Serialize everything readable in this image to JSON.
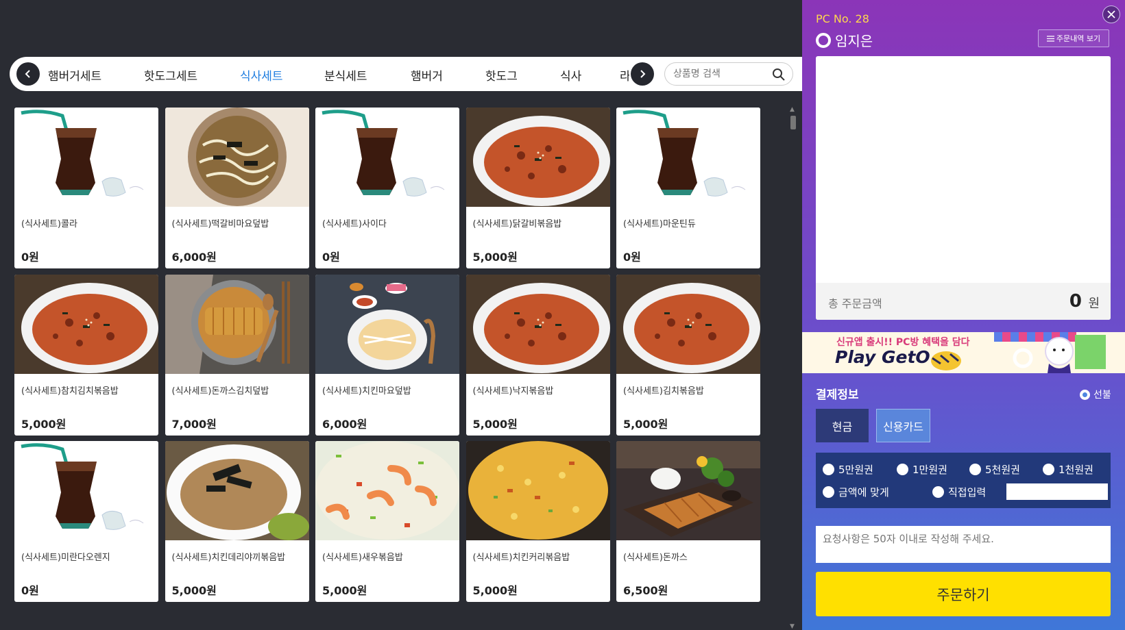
{
  "categories": {
    "items": [
      "햄버거세트",
      "핫도그세트",
      "식사세트",
      "분식세트",
      "햄버거",
      "핫도그",
      "식사"
    ],
    "active_index": 2,
    "clipped_next": "라"
  },
  "search": {
    "placeholder": "상품명 검색"
  },
  "products": [
    {
      "name": "(식사세트)콜라",
      "price": "0원",
      "img": "cola"
    },
    {
      "name": "(식사세트)떡갈비마요덮밥",
      "price": "6,000원",
      "img": "mayo-bowl"
    },
    {
      "name": "(식사세트)사이다",
      "price": "0원",
      "img": "cola"
    },
    {
      "name": "(식사세트)닭갈비볶음밥",
      "price": "5,000원",
      "img": "kimchi-rice"
    },
    {
      "name": "(식사세트)마운틴듀",
      "price": "0원",
      "img": "cola"
    },
    {
      "name": "(식사세트)참치김치볶음밥",
      "price": "5,000원",
      "img": "kimchi-rice"
    },
    {
      "name": "(식사세트)돈까스김치덮밥",
      "price": "7,000원",
      "img": "katsu-bowl"
    },
    {
      "name": "(식사세트)치킨마요덮밥",
      "price": "6,000원",
      "img": "chicken-mayo"
    },
    {
      "name": "(식사세트)낙지볶음밥",
      "price": "5,000원",
      "img": "kimchi-rice"
    },
    {
      "name": "(식사세트)김치볶음밥",
      "price": "5,000원",
      "img": "kimchi-rice"
    },
    {
      "name": "(식사세트)미란다오렌지",
      "price": "0원",
      "img": "cola"
    },
    {
      "name": "(식사세트)치킨데리야끼볶음밥",
      "price": "5,000원",
      "img": "teriyaki-rice"
    },
    {
      "name": "(식사세트)새우볶음밥",
      "price": "5,000원",
      "img": "shrimp-rice"
    },
    {
      "name": "(식사세트)치킨커리볶음밥",
      "price": "5,000원",
      "img": "curry-rice"
    },
    {
      "name": "(식사세트)돈까스",
      "price": "6,500원",
      "img": "pork-cutlet"
    }
  ],
  "panel": {
    "pc_no": "PC No. 28",
    "user_name": "임지은",
    "history_label": "주문내역 보기",
    "total_label": "총 주문금액",
    "total_value": "0",
    "total_unit": "원",
    "banner_line1": "신규앱 출시!! PC방 혜택을 담다",
    "banner_line2": "Play GetO",
    "pay_title": "결제정보",
    "prepaid_label": "선불",
    "tab_cash": "현금",
    "tab_card": "신용카드",
    "cash_options": [
      "5만원권",
      "1만원권",
      "5천원권",
      "1천원권",
      "금액에 맞게",
      "직접입력"
    ],
    "request_placeholder": "요청사항은 50자 이내로 작성해 주세요.",
    "order_button": "주문하기"
  },
  "colors": {
    "accent_active": "#1e7de0",
    "order_button": "#ffe000",
    "panel_top": "#8b35b8",
    "panel_bottom": "#3f77d8",
    "pc_no": "#ffd84d"
  }
}
